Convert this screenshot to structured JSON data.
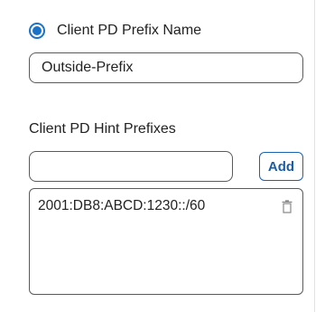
{
  "client_pd_prefix": {
    "radio_label": "Client PD Prefix Name",
    "selected": true,
    "input_value": "Outside-Prefix"
  },
  "hint_prefixes": {
    "title": "Client PD Hint Prefixes",
    "input_value": "",
    "add_label": "Add",
    "items": [
      {
        "label": "2001:DB8:ABCD:1230::/60",
        "delete_icon": "trash-icon"
      }
    ]
  },
  "colors": {
    "accent": "#1a73c8",
    "button_text": "#1a5ea8",
    "border": "#5a5a5a"
  }
}
